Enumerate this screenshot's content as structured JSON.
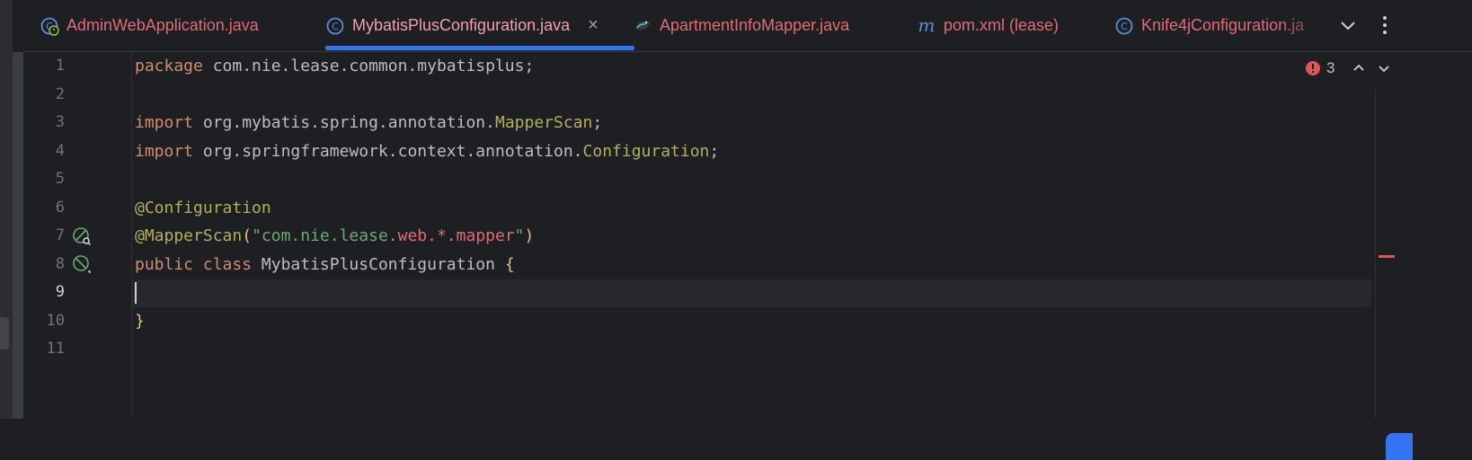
{
  "tabs": [
    {
      "label": "AdminWebApplication.java",
      "icon": "spring-boot-class-icon",
      "state": "error"
    },
    {
      "label": "MybatisPlusConfiguration.java",
      "icon": "class-icon",
      "state": "active"
    },
    {
      "label": "ApartmentInfoMapper.java",
      "icon": "mybatis-mapper-icon",
      "state": "error"
    },
    {
      "label": "pom.xml (lease)",
      "icon": "maven-icon",
      "state": "error"
    },
    {
      "label": "Knife4jConfiguration.ja",
      "icon": "class-icon",
      "state": "error"
    }
  ],
  "tab_close_glyph": "×",
  "line_numbers": [
    "1",
    "2",
    "3",
    "4",
    "5",
    "6",
    "7",
    "8",
    "9",
    "10",
    "11"
  ],
  "current_line": "9",
  "code": {
    "l1_kw": "package",
    "l1_rest": " com.nie.lease.common.mybatisplus;",
    "l3_kw": "import",
    "l3_pkg": " org.mybatis.spring.annotation.",
    "l3_cls": "MapperScan",
    "l3_end": ";",
    "l4_kw": "import",
    "l4_pkg": " org.springframework.context.annotation.",
    "l4_cls": "Configuration",
    "l4_end": ";",
    "l6_ann": "@Configuration",
    "l7_ann": "@MapperScan",
    "l7_open": "(",
    "l7_str1": "\"com.nie.lease.",
    "l7_str2": "web.*.mapper",
    "l7_str3": "\"",
    "l7_close": ")",
    "l8_kw1": "public",
    "l8_kw2": "class",
    "l8_name": " MybatisPlusConfiguration ",
    "l8_brace": "{",
    "l10_brace": "}"
  },
  "inspections": {
    "error_count": "3"
  },
  "colors": {
    "accent": "#3574f0",
    "error": "#e0555a",
    "tab_error_text": "#e06c75"
  }
}
